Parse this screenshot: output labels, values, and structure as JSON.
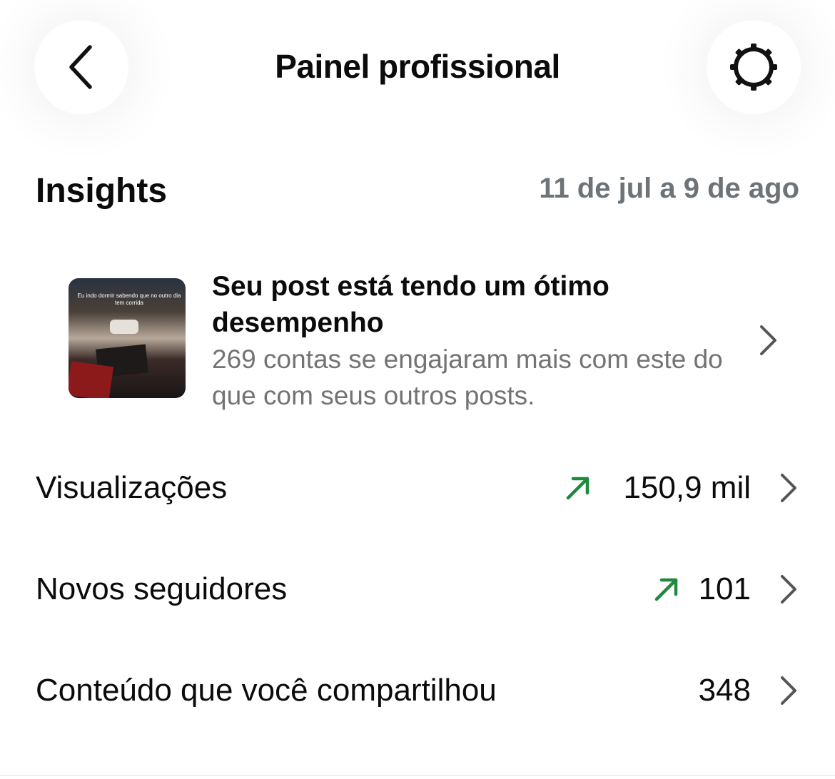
{
  "header": {
    "title": "Painel profissional",
    "back_icon": "chevron-left-icon",
    "settings_icon": "gear-icon"
  },
  "insights": {
    "title": "Insights",
    "date_range": "11 de jul a 9 de ago"
  },
  "post_highlight": {
    "thumbnail_caption": "Eu indo dormir sabendo que no outro dia tem corrida",
    "title": "Seu post está tendo um ótimo desempenho",
    "description": "269 contas se engajaram mais com este do que com seus outros posts."
  },
  "metrics": [
    {
      "label": "Visualizações",
      "value": "150,9 mil",
      "trend": "up"
    },
    {
      "label": "Novos seguidores",
      "value": "101",
      "trend": "up"
    },
    {
      "label": "Conteúdo que você compartilhou",
      "value": "348",
      "trend": null
    }
  ],
  "colors": {
    "trend_up": "#1e8a3c",
    "secondary_text": "#737373",
    "date_text": "#6e7378",
    "chevron": "#555555"
  }
}
